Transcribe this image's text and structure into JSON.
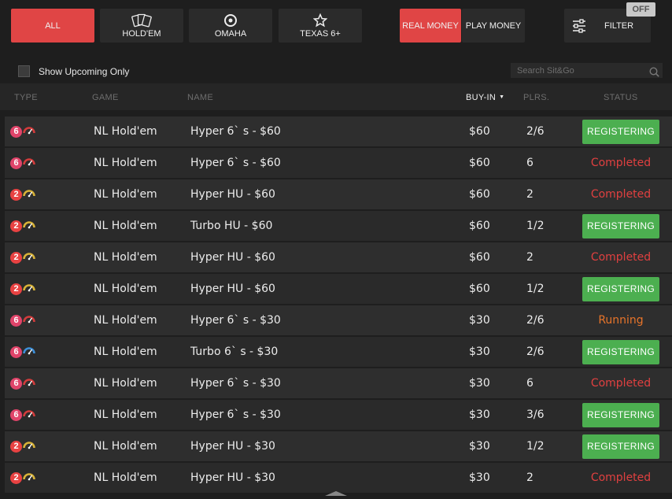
{
  "game_tabs": [
    {
      "label": "ALL",
      "active": true
    },
    {
      "label": "HOLD'EM",
      "icon": "cards-icon"
    },
    {
      "label": "OMAHA",
      "icon": "chip-icon"
    },
    {
      "label": "TEXAS 6+",
      "icon": "star-icon"
    }
  ],
  "money_tabs": [
    {
      "label": "REAL MONEY",
      "active": true
    },
    {
      "label": "PLAY MONEY"
    }
  ],
  "filter": {
    "label": "FILTER",
    "toggle": "OFF",
    "icon": "sliders-icon"
  },
  "show_upcoming_label": "Show Upcoming Only",
  "search_placeholder": "Search Sit&Go",
  "columns": {
    "type": "TYPE",
    "game": "GAME",
    "name": "NAME",
    "buyin": "BUY-IN",
    "plrs": "PLRS.",
    "status": "STATUS"
  },
  "colors": {
    "accent": "#e04545",
    "register": "#4caf50",
    "completed": "#e04040",
    "running": "#e8742a",
    "six_badge": "#e0446a",
    "two_badge": "#e84242",
    "gauge_red": "#d23c3c",
    "gauge_yellow": "#d7b238",
    "gauge_blue": "#3d8fd8"
  },
  "rows": [
    {
      "badge": "6",
      "speed": "hyper",
      "game": "NL Hold'em",
      "name": "Hyper 6` s - $60",
      "buyin": "$60",
      "plrs": "2/6",
      "status": "REGISTERING"
    },
    {
      "badge": "6",
      "speed": "hyper",
      "game": "NL Hold'em",
      "name": "Hyper 6` s - $60",
      "buyin": "$60",
      "plrs": "6",
      "status": "Completed"
    },
    {
      "badge": "2",
      "speed": "hyper-hu",
      "game": "NL Hold'em",
      "name": "Hyper HU - $60",
      "buyin": "$60",
      "plrs": "2",
      "status": "Completed"
    },
    {
      "badge": "2",
      "speed": "turbo-hu",
      "game": "NL Hold'em",
      "name": "Turbo HU - $60",
      "buyin": "$60",
      "plrs": "1/2",
      "status": "REGISTERING"
    },
    {
      "badge": "2",
      "speed": "hyper-hu",
      "game": "NL Hold'em",
      "name": "Hyper HU - $60",
      "buyin": "$60",
      "plrs": "2",
      "status": "Completed"
    },
    {
      "badge": "2",
      "speed": "hyper-hu",
      "game": "NL Hold'em",
      "name": "Hyper HU - $60",
      "buyin": "$60",
      "plrs": "1/2",
      "status": "REGISTERING"
    },
    {
      "badge": "6",
      "speed": "hyper",
      "game": "NL Hold'em",
      "name": "Hyper 6` s - $30",
      "buyin": "$30",
      "plrs": "2/6",
      "status": "Running"
    },
    {
      "badge": "6",
      "speed": "turbo",
      "game": "NL Hold'em",
      "name": "Turbo 6` s - $30",
      "buyin": "$30",
      "plrs": "2/6",
      "status": "REGISTERING"
    },
    {
      "badge": "6",
      "speed": "hyper",
      "game": "NL Hold'em",
      "name": "Hyper 6` s - $30",
      "buyin": "$30",
      "plrs": "6",
      "status": "Completed"
    },
    {
      "badge": "6",
      "speed": "hyper",
      "game": "NL Hold'em",
      "name": "Hyper 6` s - $30",
      "buyin": "$30",
      "plrs": "3/6",
      "status": "REGISTERING"
    },
    {
      "badge": "2",
      "speed": "hyper-hu",
      "game": "NL Hold'em",
      "name": "Hyper HU - $30",
      "buyin": "$30",
      "plrs": "1/2",
      "status": "REGISTERING"
    },
    {
      "badge": "2",
      "speed": "hyper-hu",
      "game": "NL Hold'em",
      "name": "Hyper HU - $30",
      "buyin": "$30",
      "plrs": "2",
      "status": "Completed"
    }
  ]
}
